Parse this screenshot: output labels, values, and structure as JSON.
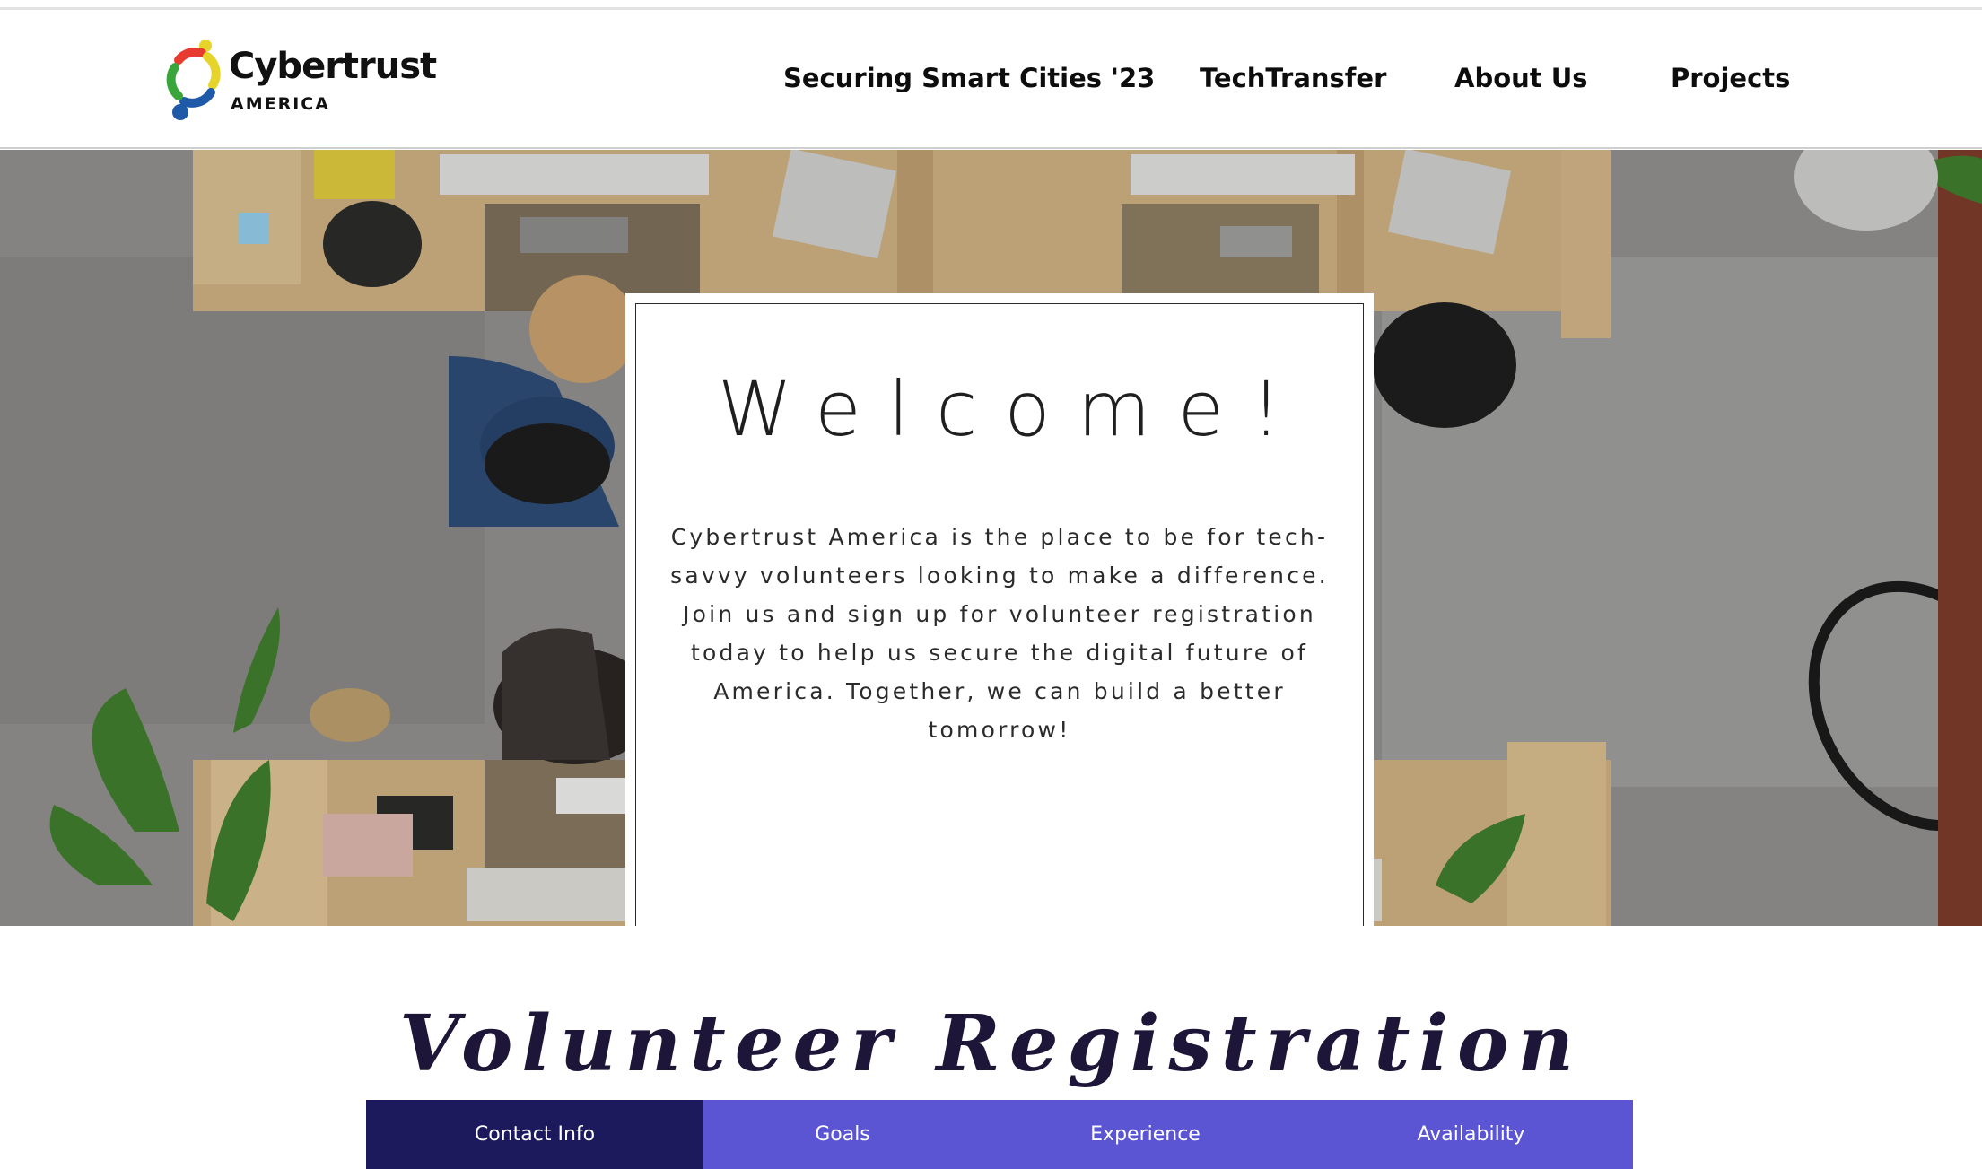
{
  "header": {
    "logo": {
      "name": "Cybertrust",
      "sub": "AMERICA"
    },
    "nav": [
      {
        "label": "Securing Smart Cities '23"
      },
      {
        "label": "TechTransfer"
      },
      {
        "label": "About Us"
      },
      {
        "label": "Projects"
      }
    ]
  },
  "hero": {
    "title": "Welcome!",
    "body": "Cybertrust America is the place to be for tech-savvy volunteers looking to make a difference. Join us and sign up for volunteer registration today to help us secure the digital future of America. Together, we can build a better tomorrow!",
    "image": "overhead view of office desks with people working at computers"
  },
  "registration": {
    "title": "Volunteer Registration",
    "tabs": [
      {
        "label": "Contact Info",
        "active": true
      },
      {
        "label": "Goals",
        "active": false
      },
      {
        "label": "Experience",
        "active": false
      },
      {
        "label": "Availability",
        "active": false
      }
    ]
  },
  "colors": {
    "tab_active": "#1c1a5c",
    "tab_bg": "#5b55d3",
    "reg_title": "#1e1638",
    "logo_red": "#e63b2e",
    "logo_yellow": "#e6d42a",
    "logo_green": "#3aa53a",
    "logo_blue": "#1f5aa8"
  }
}
